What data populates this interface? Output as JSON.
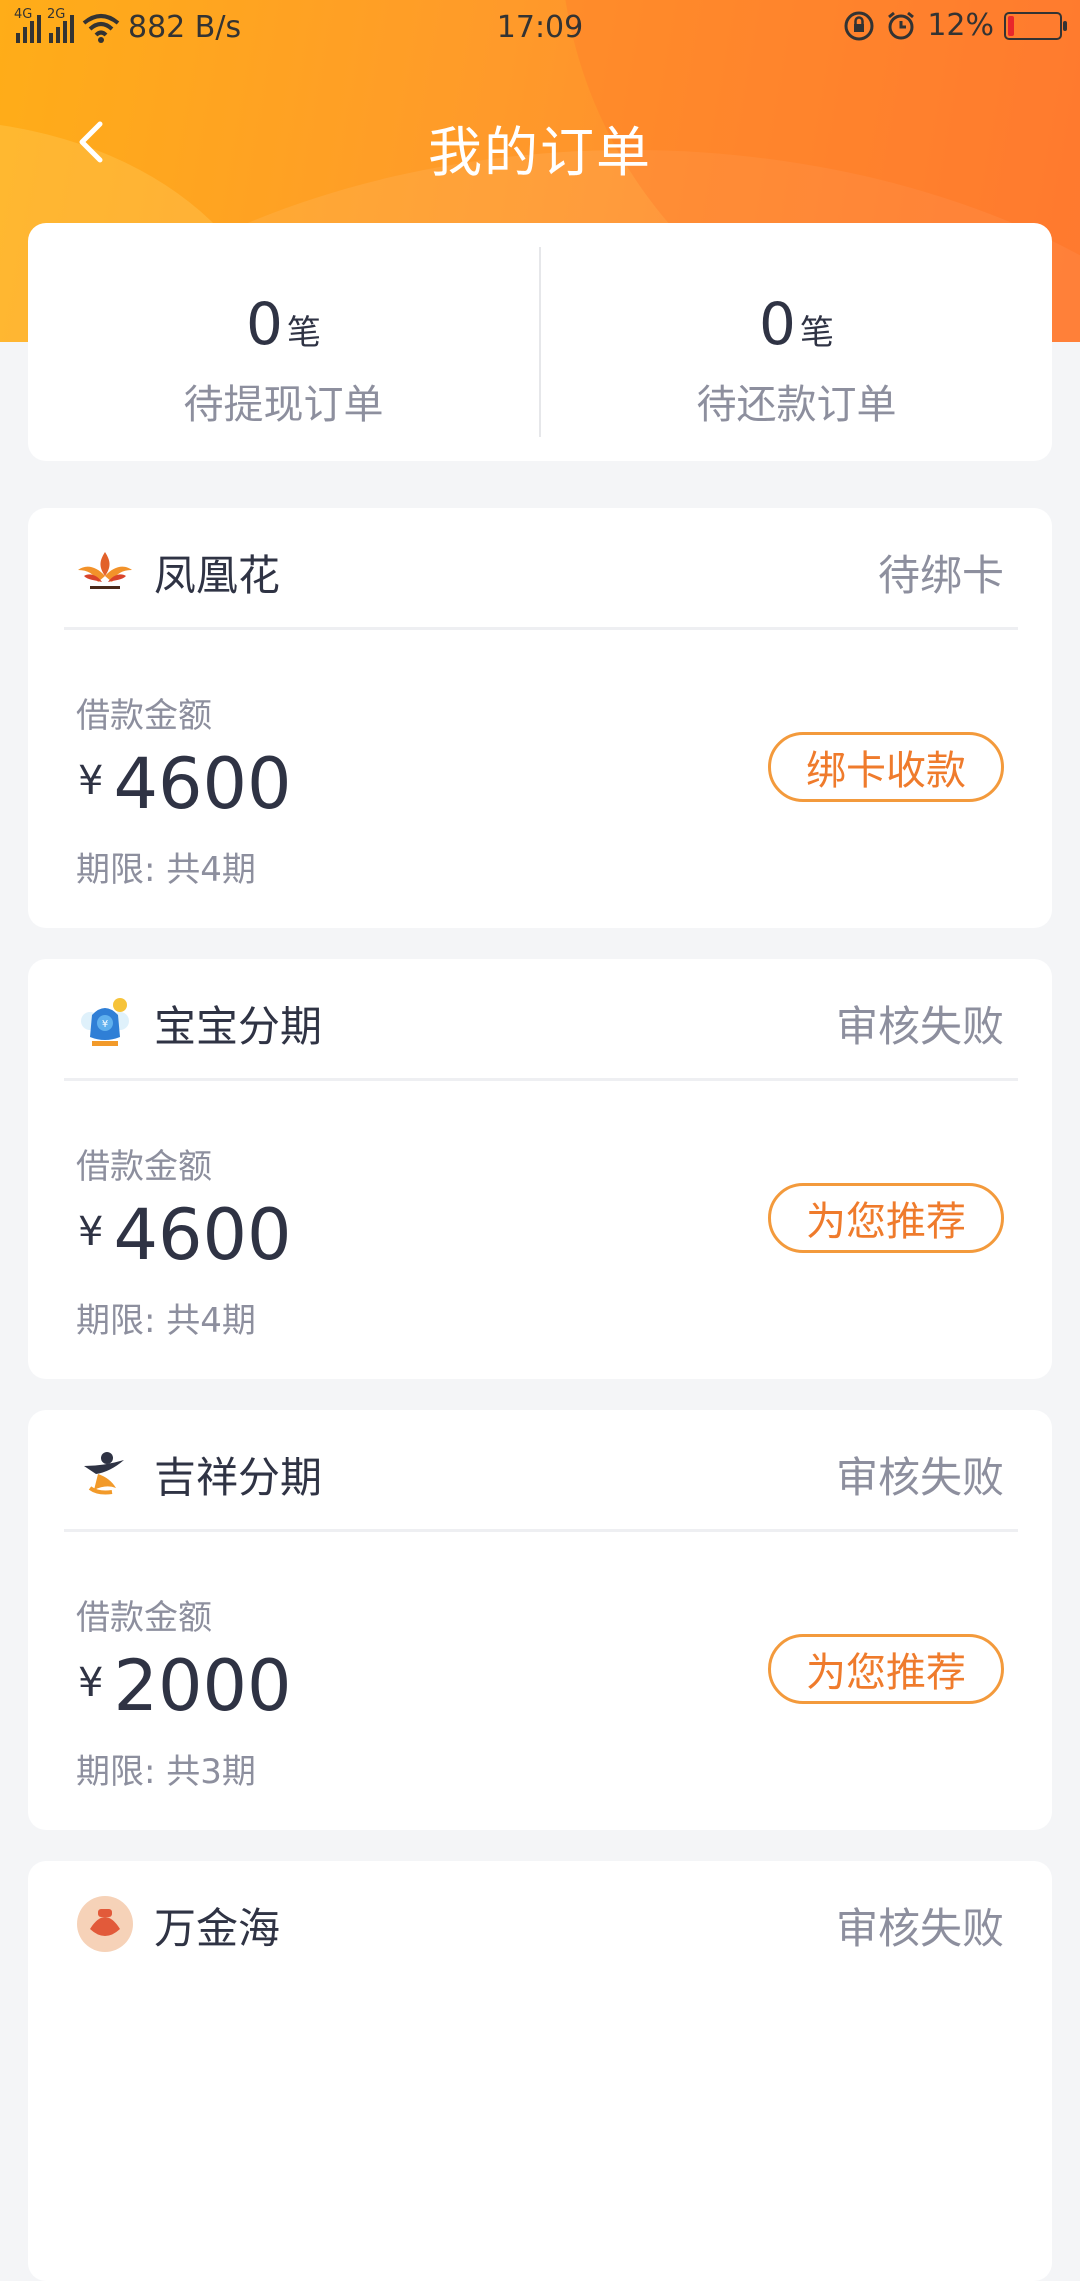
{
  "status_bar": {
    "net_4g": "4G",
    "net_2g": "2G",
    "speed": "882 B/s",
    "time": "17:09",
    "battery": "12%",
    "battery_level": 0.12
  },
  "header": {
    "title": "我的订单"
  },
  "summary": {
    "withdraw_count": "0",
    "withdraw_unit": "笔",
    "withdraw_label": "待提现订单",
    "repay_count": "0",
    "repay_unit": "笔",
    "repay_label": "待还款订单"
  },
  "colors": {
    "accent_orange": "#ff9a2a",
    "button_border": "#f39a3c",
    "button_text": "#ef7b2c",
    "battery_low": "#e8272b"
  },
  "orders": [
    {
      "name": "凤凰花",
      "logo_icon": "phoenix-logo-icon",
      "status": "待绑卡",
      "amount_label": "借款金额",
      "currency": "¥",
      "amount": "4600",
      "term": "期限: 共4期",
      "action": "绑卡收款"
    },
    {
      "name": "宝宝分期",
      "logo_icon": "baobao-logo-icon",
      "status": "审核失败",
      "amount_label": "借款金额",
      "currency": "¥",
      "amount": "4600",
      "term": "期限: 共4期",
      "action": "为您推荐"
    },
    {
      "name": "吉祥分期",
      "logo_icon": "jixiang-logo-icon",
      "status": "审核失败",
      "amount_label": "借款金额",
      "currency": "¥",
      "amount": "2000",
      "term": "期限: 共3期",
      "action": "为您推荐"
    },
    {
      "name": "万金海",
      "logo_icon": "wanjinhai-logo-icon",
      "status": "审核失败"
    }
  ]
}
